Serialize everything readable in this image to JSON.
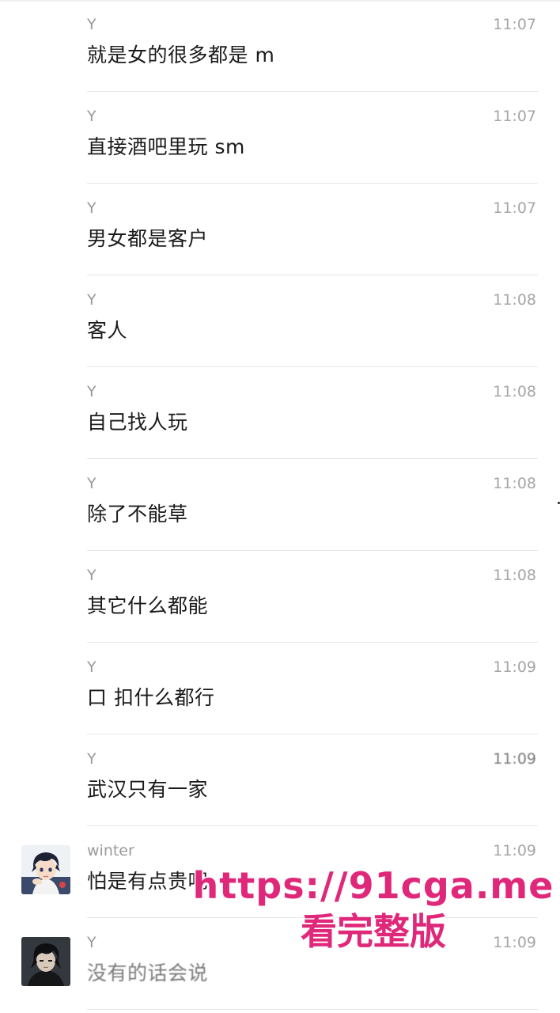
{
  "messages": [
    {
      "sender": "Y",
      "time": "11:07",
      "text": "就是女的很多都是 m"
    },
    {
      "sender": "Y",
      "time": "11:07",
      "text": "直接酒吧里玩 sm"
    },
    {
      "sender": "Y",
      "time": "11:07",
      "text": "男女都是客户"
    },
    {
      "sender": "Y",
      "time": "11:08",
      "text": "客人"
    },
    {
      "sender": "Y",
      "time": "11:08",
      "text": "自己找人玩"
    },
    {
      "sender": "Y",
      "time": "11:08",
      "text": "除了不能草"
    },
    {
      "sender": "Y",
      "time": "11:08",
      "text": "其它什么都能"
    },
    {
      "sender": "Y",
      "time": "11:09",
      "text": "口 扣什么都行"
    },
    {
      "sender": "Y",
      "time": "11:09",
      "text": "武汉只有一家"
    },
    {
      "sender": "winter",
      "time": "11:09",
      "text": "怕是有点贵吧",
      "avatar": "anime-boy-avatar"
    },
    {
      "sender": "Y",
      "time": "11:09",
      "text": "没有的话会说",
      "avatar": "dark-hair-avatar"
    }
  ],
  "watermark": {
    "url": "https://91cga.me",
    "subtitle": "看完整版"
  },
  "colors": {
    "sender": "#9a9a9a",
    "time": "#a6a6a6",
    "text": "#1a1a1a",
    "watermark": "#e0287a"
  }
}
